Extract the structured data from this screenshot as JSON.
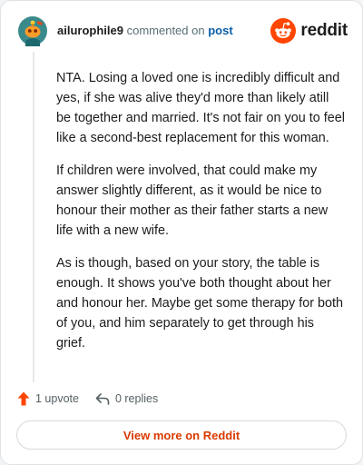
{
  "header": {
    "username": "ailurophile9",
    "action_text": "commented on",
    "target_link": "post",
    "brand_name": "reddit",
    "avatar_icon": "snoo-avatar-icon",
    "brand_icon": "reddit-logo-icon"
  },
  "comment": {
    "paragraphs": [
      "NTA. Losing a loved one is incredibly difficult and yes, if she was alive they'd more than likely atill be together and married. It's not fair on you to feel like a second-best replacement for this woman.",
      "If children were involved, that could make my answer slightly different, as it would be nice to honour their mother as their father starts a new life with a new wife.",
      "As is though, based on your story, the table is enough. It shows you've both thought about her and honour her. Maybe get some therapy for both of you, and him separately to get through his grief."
    ]
  },
  "actions": {
    "upvote_label": "1 upvote",
    "replies_label": "0 replies",
    "upvote_icon": "upvote-arrow-icon",
    "reply_icon": "reply-arrow-icon"
  },
  "footer": {
    "view_more_label": "View more on Reddit"
  },
  "colors": {
    "brand": "#ff4500",
    "link": "#0a5fa6",
    "button_text": "#d93a00",
    "text": "#1c1c1c",
    "muted": "#576f76",
    "avatar_bg": "#3a8a8c"
  }
}
